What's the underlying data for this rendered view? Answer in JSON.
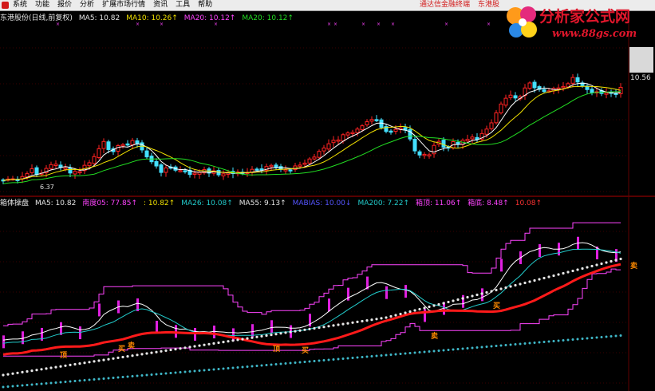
{
  "menubar": {
    "items": [
      "系统",
      "功能",
      "报价",
      "分析",
      "扩展市场行情",
      "资讯",
      "工具",
      "帮助"
    ],
    "right": [
      "通达信金融终端",
      "东港股"
    ]
  },
  "watermark": {
    "line1": "分析家公式网",
    "line2": "www.88gs.com"
  },
  "top_legend": [
    {
      "text": "东港股份(日线,前复权)",
      "color": "#e6e6e6"
    },
    {
      "text": "MA5: 10.82",
      "color": "#e6e6e6"
    },
    {
      "text": "MA10: 10.26↑",
      "color": "#f0e000"
    },
    {
      "text": "MA20: 10.12↑",
      "color": "#ff44ff"
    },
    {
      "text": "MA20: 10.12↑",
      "color": "#22dd22"
    }
  ],
  "bottom_legend": [
    {
      "text": "箱体操盘",
      "color": "#e6e6e6"
    },
    {
      "text": "MA5: 10.82",
      "color": "#e6e6e6"
    },
    {
      "text": "南度05: 77.85↑",
      "color": "#ff44ff"
    },
    {
      "text": ": 10.82↑",
      "color": "#f0e000"
    },
    {
      "text": "MA26: 10.08↑",
      "color": "#22cccc"
    },
    {
      "text": "MA55: 9.13↑",
      "color": "#e6e6e6"
    },
    {
      "text": "MABIAS: 10.00↓",
      "color": "#5555ff"
    },
    {
      "text": "MA200: 7.22↑",
      "color": "#22cccc"
    },
    {
      "text": "箱顶: 11.06↑",
      "color": "#ff44ff"
    },
    {
      "text": "箱底: 8.48↑",
      "color": "#ff44ff"
    },
    {
      "text": "10.08↑",
      "color": "#ff3333"
    }
  ],
  "price_label": "10.56",
  "low_label": "6.37",
  "annotations": [
    "顶",
    "买",
    "顶",
    "买",
    "卖",
    "买",
    "卖",
    "卖"
  ],
  "colors": {
    "up": "#ff2222",
    "down": "#44e0ff",
    "ma5": "#ffffff",
    "ma10": "#f0e000",
    "ma20": "#22dd22",
    "box": "#ff44ff",
    "thick": "#ff1a1a",
    "dots": "#e6e6e6",
    "dots2": "#3fb8c8",
    "sep": "#b00000"
  }
}
